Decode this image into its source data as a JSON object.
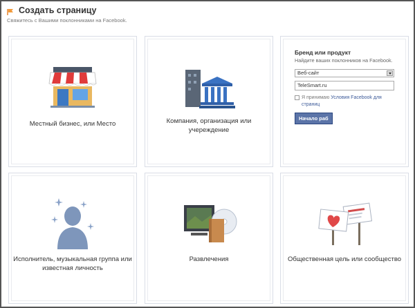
{
  "header": {
    "title": "Создать страницу",
    "subtitle": "Свяжитесь с Вашими поклонниками на Facebook."
  },
  "cards": [
    {
      "label": "Местный бизнес, или Место",
      "icon": "storefront-icon"
    },
    {
      "label": "Компания, организация или учереждение",
      "icon": "buildings-icon"
    },
    {
      "label": "Бренд или продукт",
      "icon": "none"
    },
    {
      "label": "Исполнитель, музыкальная группа или известная личность",
      "icon": "person-sparkle-icon"
    },
    {
      "label": "Развлечения",
      "icon": "tv-disc-icon"
    },
    {
      "label": "Общественная цель или сообщество",
      "icon": "signs-heart-icon"
    }
  ],
  "brand_form": {
    "title": "Бренд или продукт",
    "subtitle": "Найдите ваших поклонников на Facebook.",
    "category_value": "Веб-сайт",
    "name_value": "TeleSmart.ru",
    "agree_prefix": "Я принимаю",
    "agree_link": "Условия Facebook для страниц",
    "start_label": "Начало раб"
  },
  "colors": {
    "accent": "#3b5998",
    "button": "#5b74a8"
  }
}
